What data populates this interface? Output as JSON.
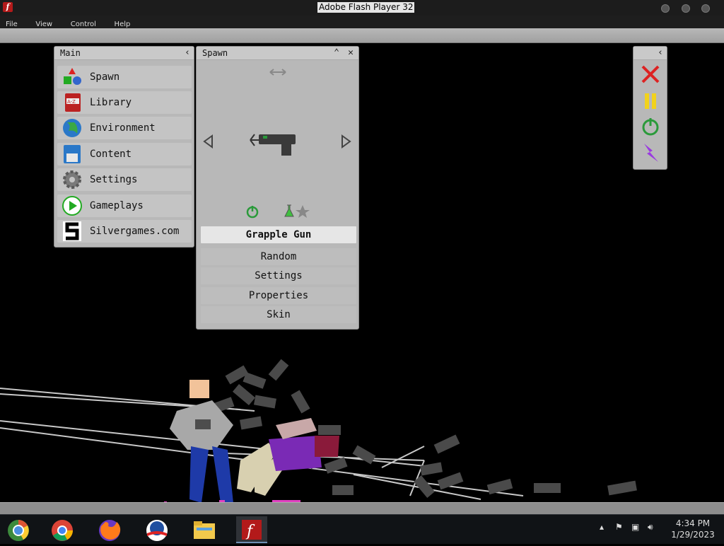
{
  "window": {
    "title": "Adobe Flash Player 32"
  },
  "menu": [
    "File",
    "View",
    "Control",
    "Help"
  ],
  "main_panel": {
    "title": "Main",
    "items": [
      {
        "label": "Spawn",
        "icon": "spawn-shapes-icon"
      },
      {
        "label": "Library",
        "icon": "library-book-icon"
      },
      {
        "label": "Environment",
        "icon": "globe-icon"
      },
      {
        "label": "Content",
        "icon": "floppy-disk-icon"
      },
      {
        "label": "Settings",
        "icon": "gear-icon"
      },
      {
        "label": "Gameplays",
        "icon": "play-icon"
      },
      {
        "label": "Silvergames.com",
        "icon": "silvergames-logo-icon"
      }
    ]
  },
  "spawn_panel": {
    "title": "Spawn",
    "selected_item": "Grapple Gun",
    "buttons": [
      "Random",
      "Settings",
      "Properties",
      "Skin"
    ]
  },
  "taskbar": {
    "apps": [
      "Chrome (old)",
      "Chrome",
      "Firefox",
      "Obama Campaign",
      "File Explorer",
      "Adobe Flash Player"
    ],
    "time": "4:34 PM",
    "date": "1/29/2023"
  }
}
